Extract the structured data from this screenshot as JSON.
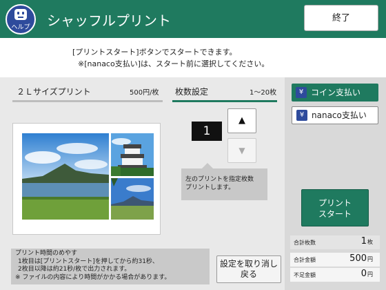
{
  "header": {
    "title": "シャッフルプリント",
    "help_label": "ヘルプ",
    "end_label": "終了"
  },
  "instructions": {
    "line1": "[プリントスタート]ボタンでスタートできます。",
    "line2": "※[nanaco支払い]は、スタート前に選択してください。"
  },
  "product": {
    "name": "２Ｌサイズプリント",
    "price": "500円/枚"
  },
  "quantity": {
    "label": "枚数設定",
    "range": "1〜20枚",
    "value": "1",
    "up_symbol": "▲",
    "down_symbol": "▼"
  },
  "tooltip": {
    "line1": "左のプリントを指定枚数",
    "line2": "プリントします。"
  },
  "note": {
    "lines": [
      "プリント時間のめやす",
      "1枚目は[プリントスタート]を押してから約31秒、",
      "2枚目以降は約21秒/枚で出力されます。",
      "※ ファイルの内容により時間がかかる場合があります。"
    ]
  },
  "reset": {
    "line1": "設定を取り消し",
    "line2": "戻る"
  },
  "payment": {
    "coin_label": "コイン支払い",
    "nanaco_label": "nanaco支払い",
    "yen_symbol": "¥"
  },
  "print_start": {
    "line1": "プリント",
    "line2": "スタート"
  },
  "summary": {
    "total_count_label": "合計枚数",
    "total_count": "1",
    "total_count_unit": "枚",
    "total_amount_label": "合計金額",
    "total_amount": "500",
    "total_amount_unit": "円",
    "shortage_label": "不足金額",
    "shortage": "0",
    "shortage_unit": "円"
  },
  "colors": {
    "brand_green": "#1f7a5f",
    "help_blue": "#2e4b9c"
  }
}
